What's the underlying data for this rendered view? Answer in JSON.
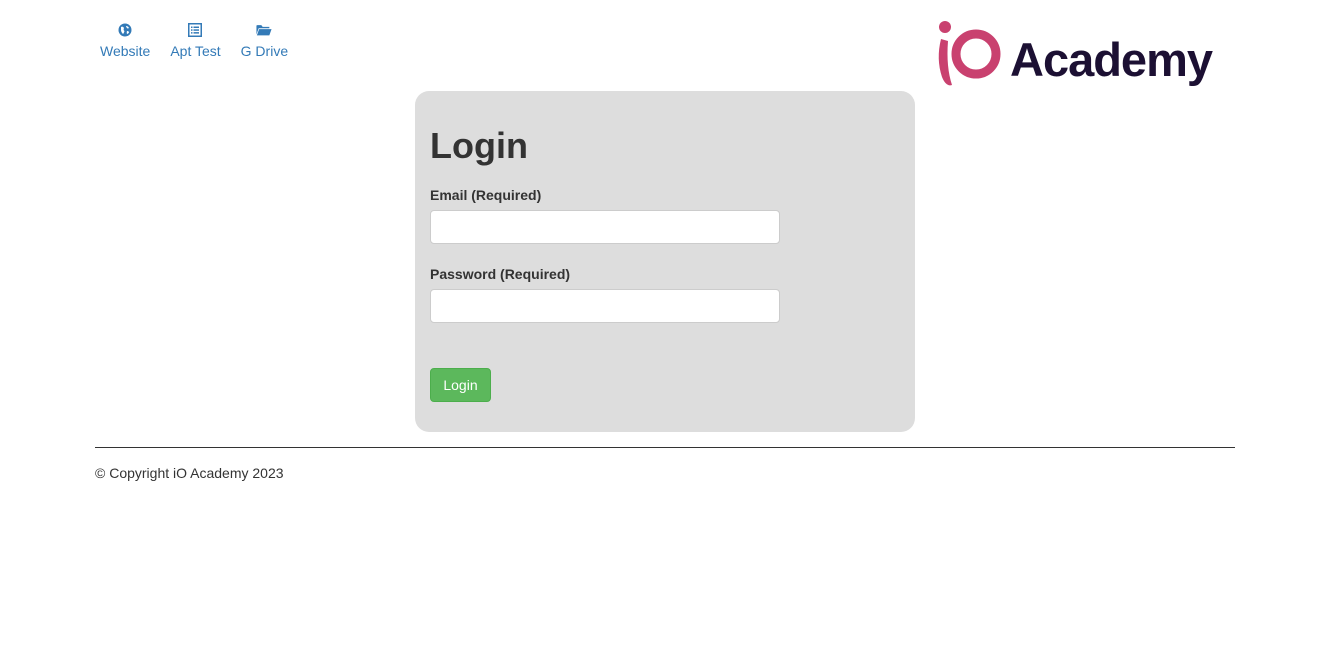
{
  "nav": {
    "items": [
      {
        "label": "Website",
        "icon": "globe-icon"
      },
      {
        "label": "Apt Test",
        "icon": "list-alt-icon"
      },
      {
        "label": "G Drive",
        "icon": "folder-open-icon"
      }
    ]
  },
  "logo": {
    "text": "iO Academy",
    "word": "Academy",
    "mark": "iO",
    "colors": {
      "mark": "#c9416f",
      "word": "#1c1033"
    }
  },
  "login": {
    "title": "Login",
    "email_label": "Email (Required)",
    "email_value": "",
    "password_label": "Password (Required)",
    "password_value": "",
    "button_label": "Login"
  },
  "footer": {
    "copyright": "© Copyright iO Academy 2023"
  },
  "colors": {
    "link": "#337ab7",
    "panel_bg": "#dddddd",
    "button_bg": "#5cb85c",
    "text": "#333333"
  }
}
